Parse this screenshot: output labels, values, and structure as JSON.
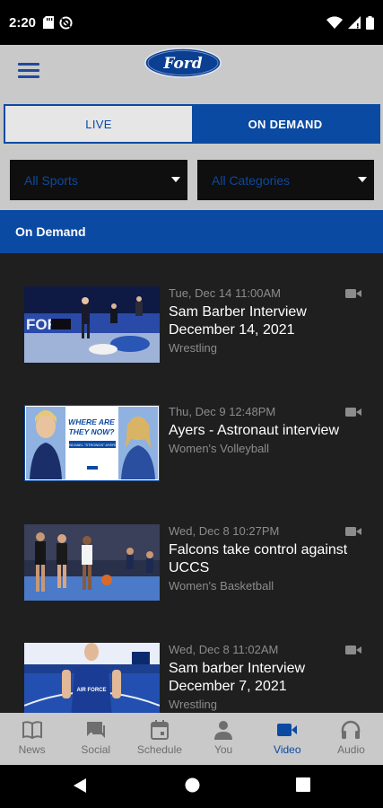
{
  "status_bar": {
    "time": "2:20"
  },
  "header": {
    "logo_text": "Ford"
  },
  "mode_toggle": {
    "live_label": "LIVE",
    "on_demand_label": "ON DEMAND",
    "selected": "ON DEMAND"
  },
  "filters": {
    "sports_value": "All Sports",
    "categories_value": "All Categories"
  },
  "section": {
    "title": "On Demand"
  },
  "videos": [
    {
      "date": "Tue, Dec 14 11:00AM",
      "title": "Sam Barber Interview December 14, 2021",
      "category": "Wrestling"
    },
    {
      "date": "Thu, Dec 9 12:48PM",
      "title": "Ayers - Astronaut interview",
      "category": "Women's Volleyball",
      "thumb_text": "WHERE ARE THEY NOW?",
      "thumb_name": "MICHAEL \"STRONGS\" AYERS"
    },
    {
      "date": "Wed, Dec 8 10:27PM",
      "title": "Falcons take control against UCCS",
      "category": "Women's Basketball"
    },
    {
      "date": "Wed, Dec 8 11:02AM",
      "title": "Sam barber Interview December 7, 2021",
      "category": "Wrestling"
    }
  ],
  "bottom_nav": {
    "items": [
      {
        "label": "News",
        "icon": "book-icon"
      },
      {
        "label": "Social",
        "icon": "chat-icon"
      },
      {
        "label": "Schedule",
        "icon": "calendar-icon"
      },
      {
        "label": "You",
        "icon": "person-icon"
      },
      {
        "label": "Video",
        "icon": "videocam-icon",
        "active": true
      },
      {
        "label": "Audio",
        "icon": "headphones-icon"
      }
    ]
  },
  "colors": {
    "brand_blue": "#0b4aa2",
    "panel_gray": "#c9c9c9",
    "list_bg": "#1f1f1f",
    "meta_gray": "#8c8c8c"
  }
}
